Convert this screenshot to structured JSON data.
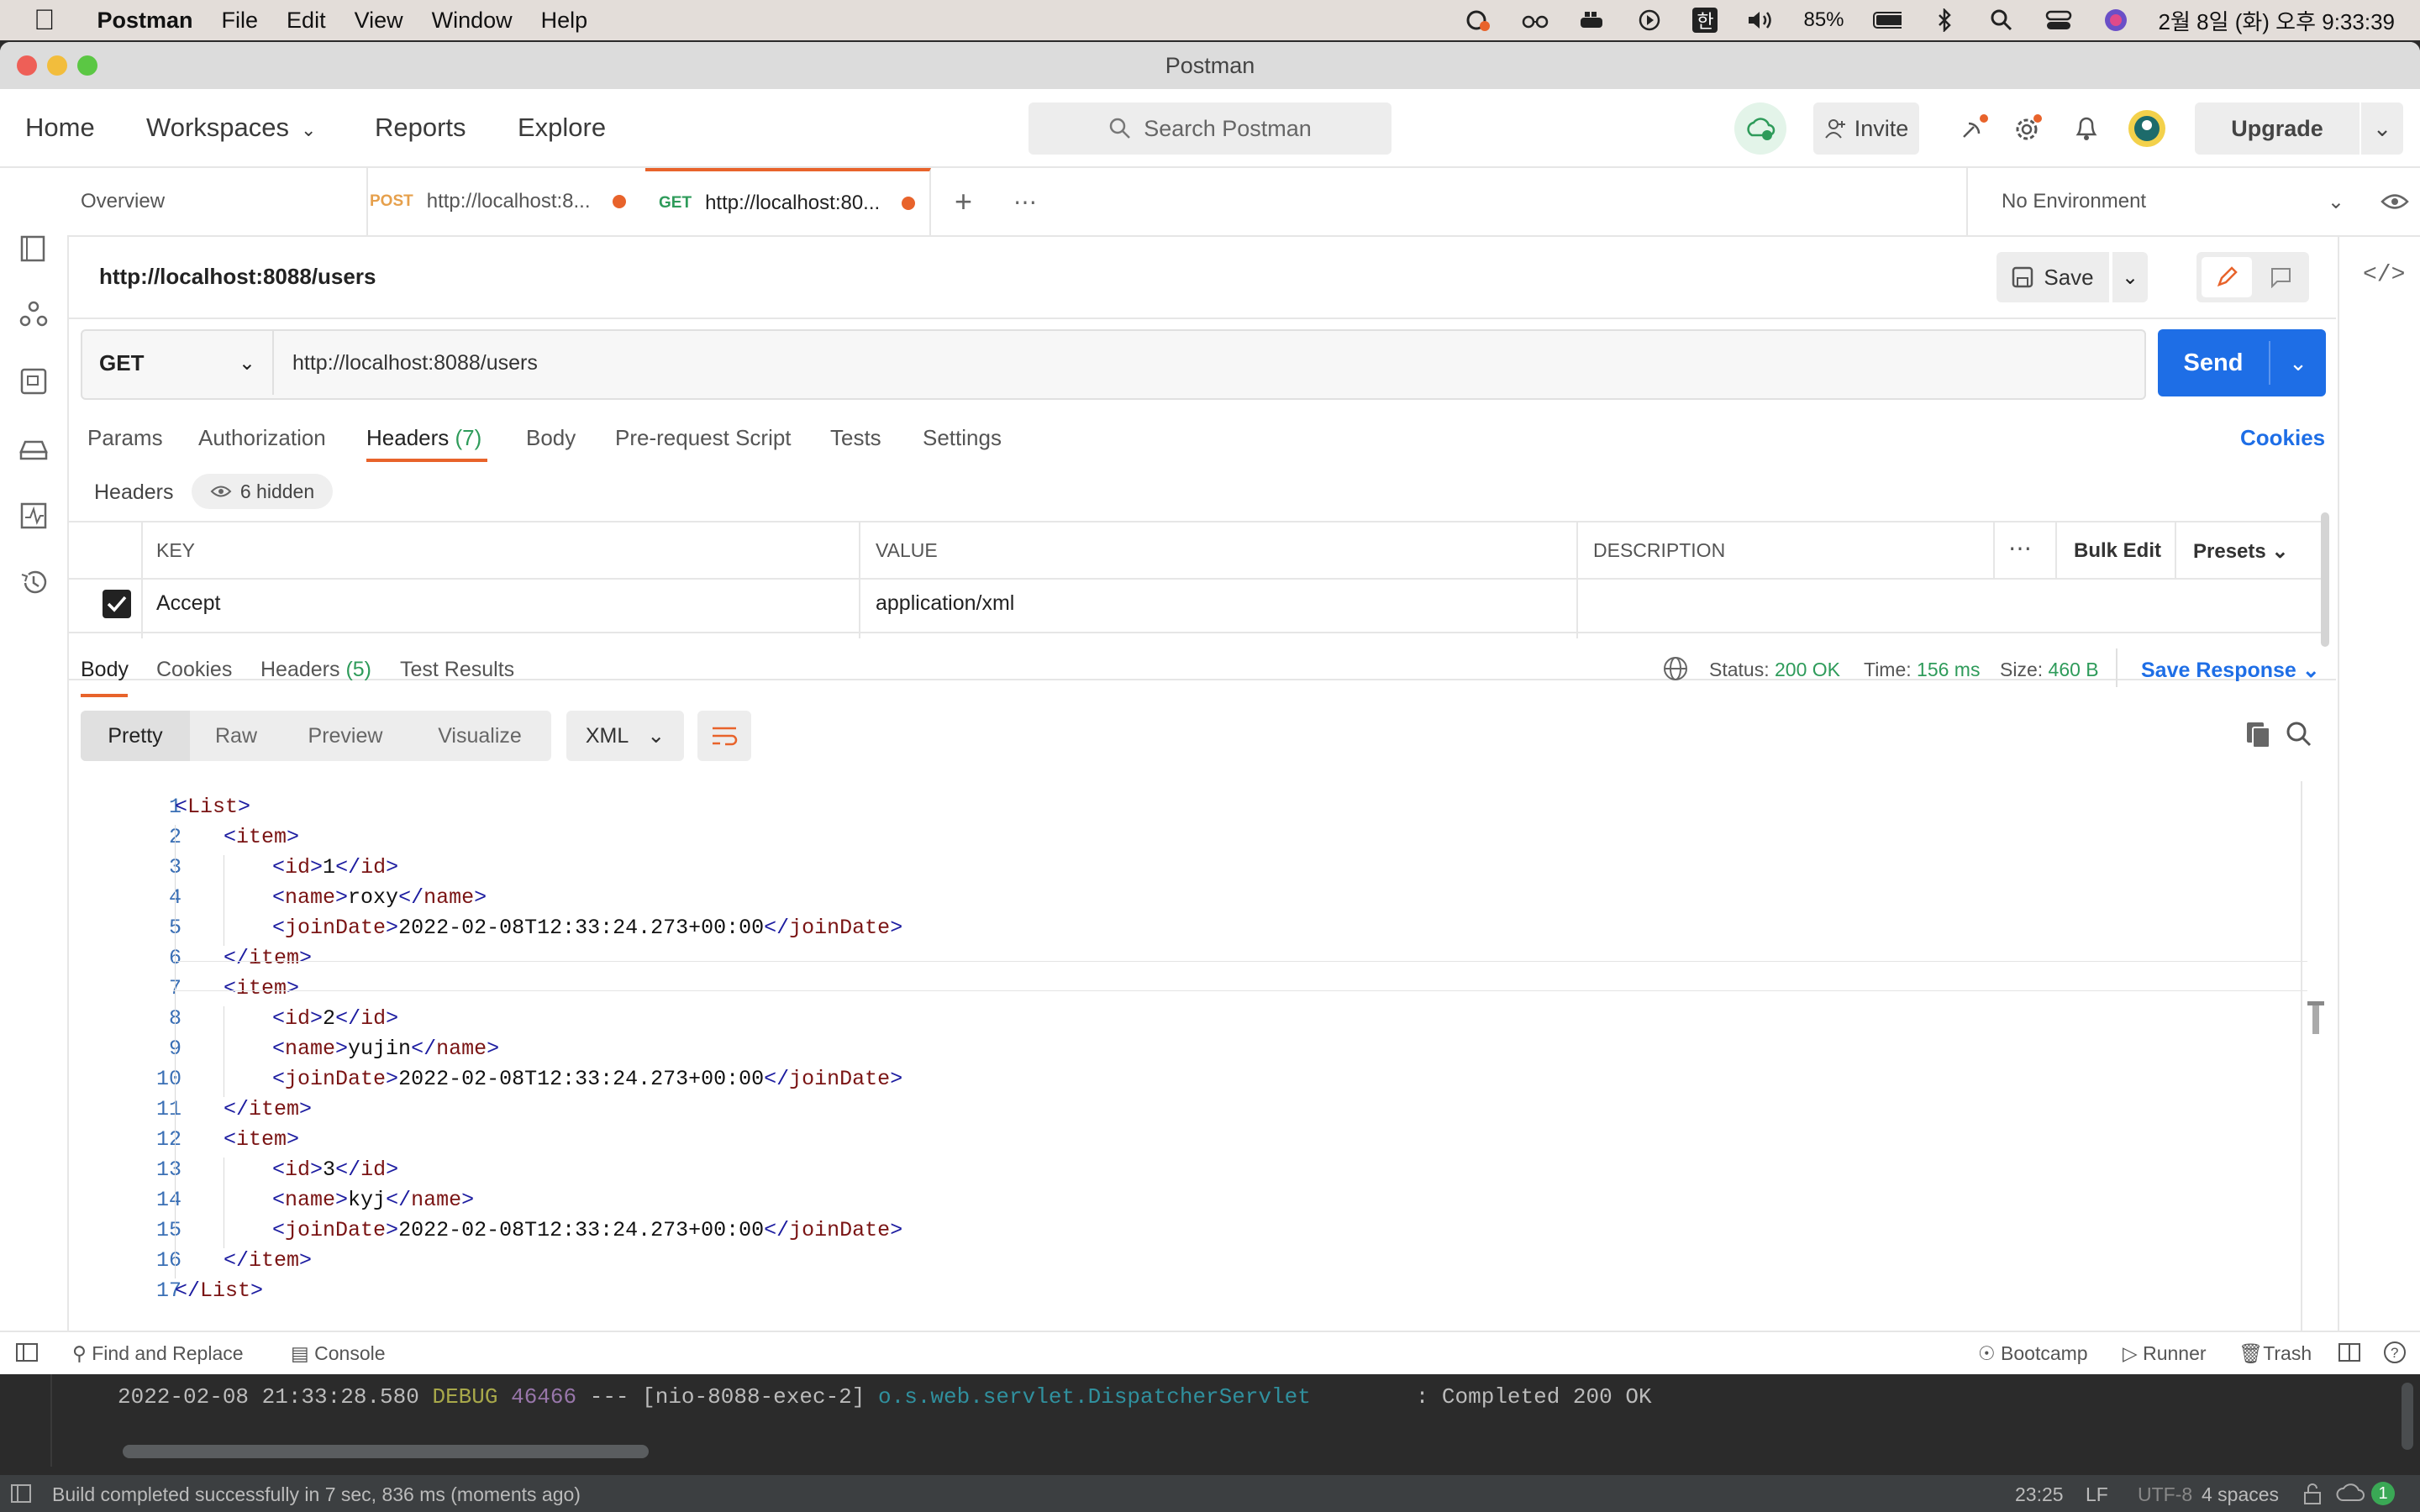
{
  "menubar": {
    "app_name": "Postman",
    "items": [
      "File",
      "Edit",
      "View",
      "Window",
      "Help"
    ],
    "battery": "85%",
    "clock": "2월 8일 (화) 오후 9:33:39",
    "ime": "한"
  },
  "window": {
    "title": "Postman"
  },
  "topnav": {
    "home": "Home",
    "workspaces": "Workspaces",
    "reports": "Reports",
    "explore": "Explore",
    "search_placeholder": "Search Postman",
    "invite": "Invite",
    "upgrade": "Upgrade"
  },
  "tabs": {
    "overview": "Overview",
    "tab1": {
      "method": "POST",
      "url": "http://localhost:8..."
    },
    "tab2": {
      "method": "GET",
      "url": "http://localhost:80..."
    },
    "environment": "No Environment"
  },
  "request": {
    "title": "http://localhost:8088/users",
    "save": "Save",
    "method": "GET",
    "url": "http://localhost:8088/users",
    "send": "Send",
    "subtabs": [
      "Params",
      "Authorization",
      "Headers",
      "Body",
      "Pre-request Script",
      "Tests",
      "Settings"
    ],
    "headers_count": "(7)",
    "cookies": "Cookies",
    "headers_label": "Headers",
    "hidden": "6 hidden",
    "columns": {
      "key": "KEY",
      "value": "VALUE",
      "description": "DESCRIPTION"
    },
    "bulk_edit": "Bulk Edit",
    "presets": "Presets",
    "rows": [
      {
        "key": "Accept",
        "value": "application/xml",
        "description": ""
      }
    ]
  },
  "response": {
    "tabs": [
      "Body",
      "Cookies",
      "Headers",
      "Test Results"
    ],
    "headers_count": "(5)",
    "status_label": "Status:",
    "status_value": "200 OK",
    "time_label": "Time:",
    "time_value": "156 ms",
    "size_label": "Size:",
    "size_value": "460 B",
    "save_response": "Save Response",
    "views": [
      "Pretty",
      "Raw",
      "Preview",
      "Visualize"
    ],
    "format": "XML",
    "code_lines": [
      {
        "n": "1",
        "indent": 0,
        "kind": "open",
        "tag": "List"
      },
      {
        "n": "2",
        "indent": 1,
        "kind": "open",
        "tag": "item"
      },
      {
        "n": "3",
        "indent": 2,
        "kind": "leaf",
        "tag": "id",
        "text": "1"
      },
      {
        "n": "4",
        "indent": 2,
        "kind": "leaf",
        "tag": "name",
        "text": "roxy"
      },
      {
        "n": "5",
        "indent": 2,
        "kind": "leaf",
        "tag": "joinDate",
        "text": "2022-02-08T12:33:24.273+00:00"
      },
      {
        "n": "6",
        "indent": 1,
        "kind": "close",
        "tag": "item"
      },
      {
        "n": "7",
        "indent": 1,
        "kind": "open",
        "tag": "item"
      },
      {
        "n": "8",
        "indent": 2,
        "kind": "leaf",
        "tag": "id",
        "text": "2"
      },
      {
        "n": "9",
        "indent": 2,
        "kind": "leaf",
        "tag": "name",
        "text": "yujin"
      },
      {
        "n": "10",
        "indent": 2,
        "kind": "leaf",
        "tag": "joinDate",
        "text": "2022-02-08T12:33:24.273+00:00"
      },
      {
        "n": "11",
        "indent": 1,
        "kind": "close",
        "tag": "item"
      },
      {
        "n": "12",
        "indent": 1,
        "kind": "open",
        "tag": "item"
      },
      {
        "n": "13",
        "indent": 2,
        "kind": "leaf",
        "tag": "id",
        "text": "3"
      },
      {
        "n": "14",
        "indent": 2,
        "kind": "leaf",
        "tag": "name",
        "text": "kyj"
      },
      {
        "n": "15",
        "indent": 2,
        "kind": "leaf",
        "tag": "joinDate",
        "text": "2022-02-08T12:33:24.273+00:00"
      },
      {
        "n": "16",
        "indent": 1,
        "kind": "close",
        "tag": "item"
      },
      {
        "n": "17",
        "indent": 0,
        "kind": "close",
        "tag": "List"
      }
    ]
  },
  "footer": {
    "find_replace": "Find and Replace",
    "console": "Console",
    "bootcamp": "Bootcamp",
    "runner": "Runner",
    "trash": "Trash"
  },
  "ide": {
    "log": {
      "time": "2022-02-08 21:33:28.580",
      "level": "DEBUG",
      "pid": "46466",
      "thread": "--- [nio-8088-exec-2]",
      "logger": "o.s.web.servlet.DispatcherServlet",
      "message": ": Completed 200 OK"
    },
    "build_status": "Build completed successfully in 7 sec, 836 ms (moments ago)",
    "position": "23:25",
    "line_sep": "LF",
    "encoding": "UTF-8",
    "indent": "4 spaces",
    "notifications": "1"
  },
  "colors": {
    "accent_blue": "#1e6ee6",
    "status_green": "#2e9b5a",
    "active_tab_orange": "#e8632b"
  }
}
